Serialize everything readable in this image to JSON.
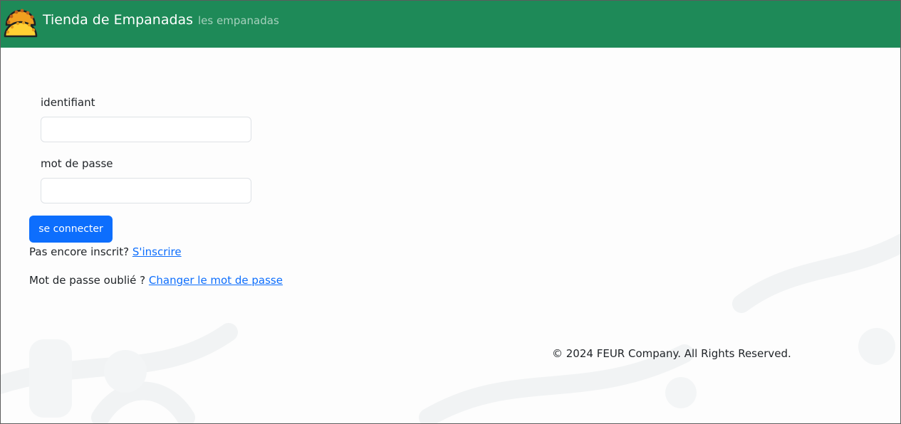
{
  "navbar": {
    "brand_name": "Tienda de Empanadas",
    "links": [
      {
        "label": "les empanadas"
      }
    ],
    "background_color": "#1e8a58"
  },
  "login_form": {
    "username_label": "identifiant",
    "username_value": "",
    "password_label": "mot de passe",
    "password_value": "",
    "submit_label": "se connecter",
    "submit_color": "#0d6efd"
  },
  "signup_prompt": {
    "text": "Pas encore inscrit?",
    "link_label": "S'inscrire"
  },
  "forgot_password": {
    "text": "Mot de passe oublié ?",
    "link_label": "Changer le mot de passe"
  },
  "footer": {
    "text": "© 2024 FEUR Company. All Rights Reserved."
  },
  "icons": {
    "logo": "empanada-logo-icon"
  },
  "link_color": "#0d6efd"
}
